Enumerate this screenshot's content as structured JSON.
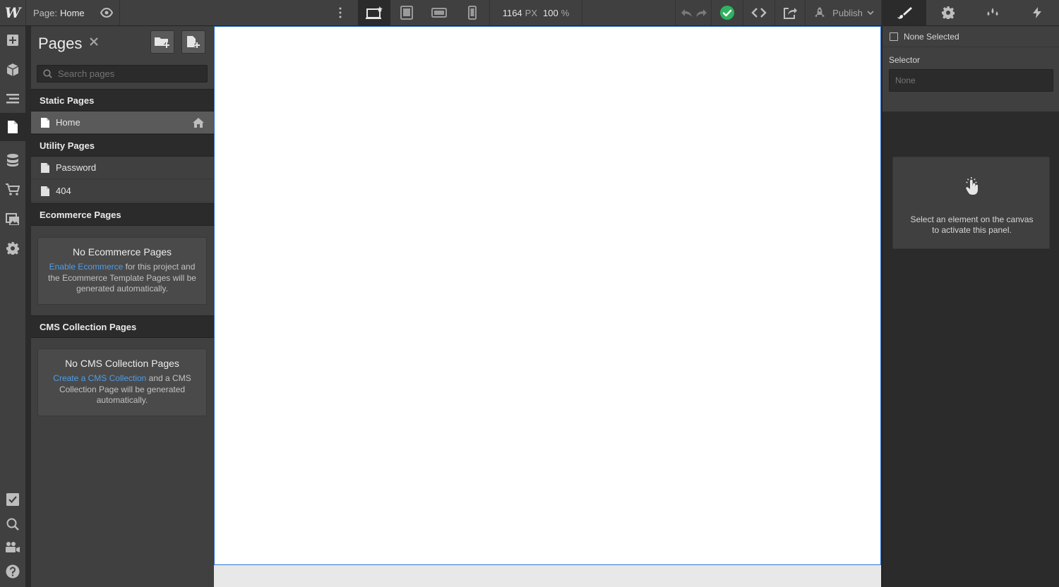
{
  "topbar": {
    "logo": "W",
    "page_label": "Page:",
    "page_name": "Home",
    "width_value": "1164",
    "width_unit": "PX",
    "zoom_value": "100",
    "zoom_unit": "%",
    "publish_label": "Publish",
    "status_color": "#2fb360",
    "icons": [
      "preview-eye-icon",
      "more-vertical-icon",
      "desktop-base-icon",
      "tablet-icon",
      "mobile-landscape-icon",
      "mobile-portrait-icon",
      "undo-icon",
      "redo-icon",
      "status-check-icon",
      "code-icon",
      "export-icon",
      "publish-icon",
      "chevron-down-icon",
      "style-brush-icon",
      "settings-gear-icon",
      "style-manager-drops-icon",
      "interactions-bolt-icon"
    ]
  },
  "rail": {
    "icons": [
      "add-icon",
      "symbols-box-icon",
      "navigator-icon",
      "pages-icon",
      "cms-database-icon",
      "ecommerce-cart-icon",
      "assets-image-icon",
      "settings-gear-icon",
      "audit-check-icon",
      "search-icon",
      "video-tutorials-icon",
      "help-icon"
    ]
  },
  "pages_panel": {
    "title": "Pages",
    "search_placeholder": "Search pages",
    "static_header": "Static Pages",
    "static_pages": [
      "Home"
    ],
    "utility_header": "Utility Pages",
    "utility_pages": [
      "Password",
      "404"
    ],
    "ecommerce_header": "Ecommerce Pages",
    "ecommerce_empty": {
      "title": "No Ecommerce Pages",
      "link": "Enable Ecommerce",
      "text": " for this project and the Ecommerce Template Pages will be generated automatically."
    },
    "cms_header": "CMS Collection Pages",
    "cms_empty": {
      "title": "No CMS Collection Pages",
      "link": "Create a CMS Collection",
      "text": " and a CMS Collection Page will be generated automatically."
    }
  },
  "right_panel": {
    "none_selected": "None Selected",
    "selector_label": "Selector",
    "selector_placeholder": "None",
    "hint_line1": "Select an element on the canvas",
    "hint_line2": "to activate this panel."
  },
  "colors": {
    "accent": "#4f9de8",
    "canvas_border": "#2e73cf"
  }
}
